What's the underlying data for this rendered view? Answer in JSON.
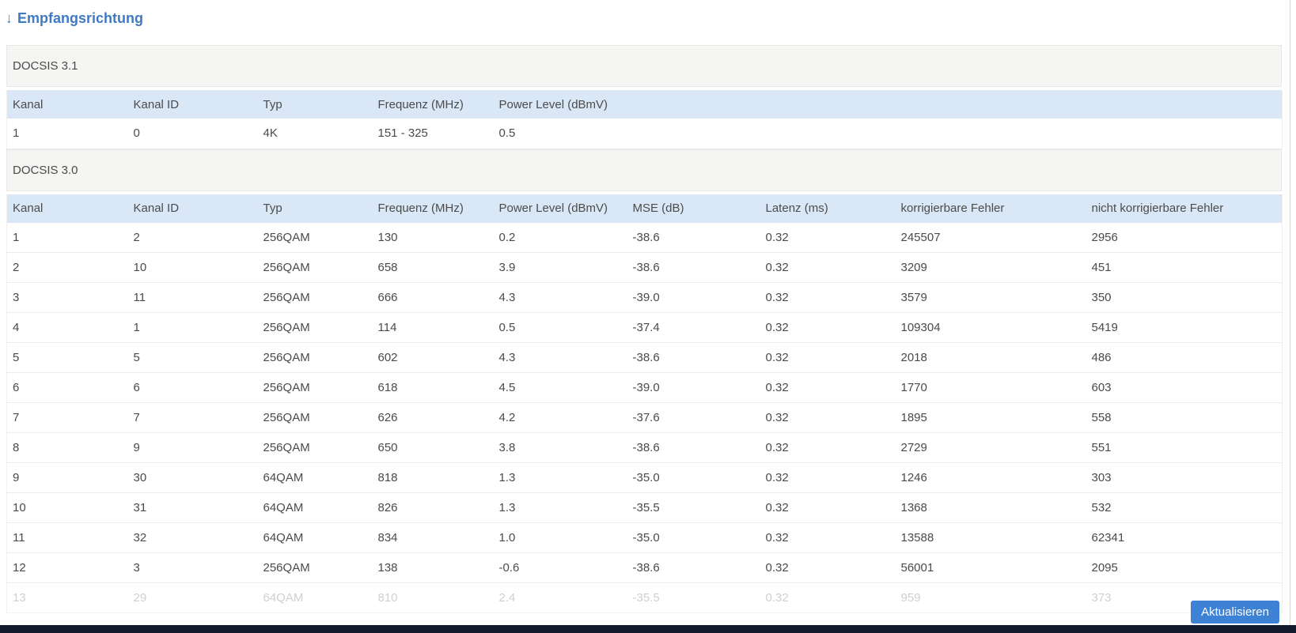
{
  "page": {
    "title_arrow": "↓",
    "title": "Empfangsrichtung"
  },
  "sections": [
    {
      "name": "DOCSIS 3.1",
      "columns": [
        "Kanal",
        "Kanal ID",
        "Typ",
        "Frequenz (MHz)",
        "Power Level (dBmV)"
      ],
      "rows": [
        [
          "1",
          "0",
          "4K",
          "151 - 325",
          "0.5"
        ]
      ],
      "faded_last_row": false
    },
    {
      "name": "DOCSIS 3.0",
      "columns": [
        "Kanal",
        "Kanal ID",
        "Typ",
        "Frequenz (MHz)",
        "Power Level (dBmV)",
        "MSE (dB)",
        "Latenz (ms)",
        "korrigierbare Fehler",
        "nicht korrigierbare Fehler"
      ],
      "rows": [
        [
          "1",
          "2",
          "256QAM",
          "130",
          "0.2",
          "-38.6",
          "0.32",
          "245507",
          "2956"
        ],
        [
          "2",
          "10",
          "256QAM",
          "658",
          "3.9",
          "-38.6",
          "0.32",
          "3209",
          "451"
        ],
        [
          "3",
          "11",
          "256QAM",
          "666",
          "4.3",
          "-39.0",
          "0.32",
          "3579",
          "350"
        ],
        [
          "4",
          "1",
          "256QAM",
          "114",
          "0.5",
          "-37.4",
          "0.32",
          "109304",
          "5419"
        ],
        [
          "5",
          "5",
          "256QAM",
          "602",
          "4.3",
          "-38.6",
          "0.32",
          "2018",
          "486"
        ],
        [
          "6",
          "6",
          "256QAM",
          "618",
          "4.5",
          "-39.0",
          "0.32",
          "1770",
          "603"
        ],
        [
          "7",
          "7",
          "256QAM",
          "626",
          "4.2",
          "-37.6",
          "0.32",
          "1895",
          "558"
        ],
        [
          "8",
          "9",
          "256QAM",
          "650",
          "3.8",
          "-38.6",
          "0.32",
          "2729",
          "551"
        ],
        [
          "9",
          "30",
          "64QAM",
          "818",
          "1.3",
          "-35.0",
          "0.32",
          "1246",
          "303"
        ],
        [
          "10",
          "31",
          "64QAM",
          "826",
          "1.3",
          "-35.5",
          "0.32",
          "1368",
          "532"
        ],
        [
          "11",
          "32",
          "64QAM",
          "834",
          "1.0",
          "-35.0",
          "0.32",
          "13588",
          "62341"
        ],
        [
          "12",
          "3",
          "256QAM",
          "138",
          "-0.6",
          "-38.6",
          "0.32",
          "56001",
          "2095"
        ],
        [
          "13",
          "29",
          "64QAM",
          "810",
          "2.4",
          "-35.5",
          "0.32",
          "959",
          "373"
        ]
      ],
      "faded_last_row": true
    }
  ],
  "footer": {
    "refresh_label": "Aktualisieren"
  },
  "colors": {
    "title_blue": "#3f7ac2",
    "header_row_bg": "#d9e7f6",
    "section_bg": "#f5f5f3",
    "button_blue": "#3e82d6",
    "bottom_bar_bg": "#111a2c"
  }
}
